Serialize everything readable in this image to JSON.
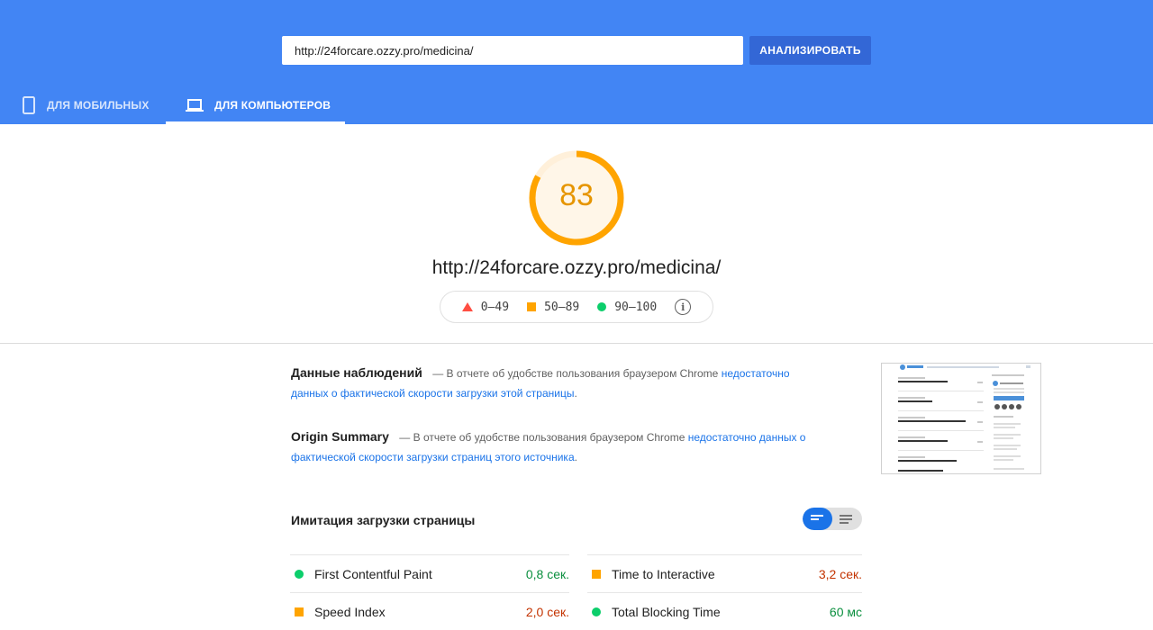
{
  "header": {
    "url_value": "http://24forcare.ozzy.pro/medicina/",
    "analyze_label": "АНАЛИЗИРОВАТЬ",
    "tabs": [
      {
        "label": "ДЛЯ МОБИЛЬНЫХ",
        "icon": "smartphone-icon",
        "active": false
      },
      {
        "label": "ДЛЯ КОМПЬЮТЕРОВ",
        "icon": "laptop-icon",
        "active": true
      }
    ],
    "color": "#4285f4"
  },
  "score": {
    "value": "83",
    "fraction": 0.83,
    "color": "#ffa400",
    "url": "http://24forcare.ozzy.pro/medicina/"
  },
  "legend": {
    "fail": "0–49",
    "average": "50–89",
    "pass": "90–100"
  },
  "field_data": {
    "title": "Данные наблюдений",
    "text": "— В отчете об удобстве пользования браузером Chrome",
    "link": "недостаточно данных о фактической скорости загрузки этой страницы",
    "end": "."
  },
  "origin_summary": {
    "title": "Origin Summary",
    "text": "— В отчете об удобстве пользования браузером Chrome",
    "link": "недостаточно данных о фактической скорости загрузки страниц этого источника",
    "end": "."
  },
  "lab": {
    "title": "Имитация загрузки страницы",
    "metrics": [
      {
        "label": "First Contentful Paint",
        "value": "0,8 сек.",
        "status": "green"
      },
      {
        "label": "Time to Interactive",
        "value": "3,2 сек.",
        "status": "orange"
      },
      {
        "label": "Speed Index",
        "value": "2,0 сек.",
        "status": "orange"
      },
      {
        "label": "Total Blocking Time",
        "value": "60 мс",
        "status": "green"
      }
    ]
  }
}
